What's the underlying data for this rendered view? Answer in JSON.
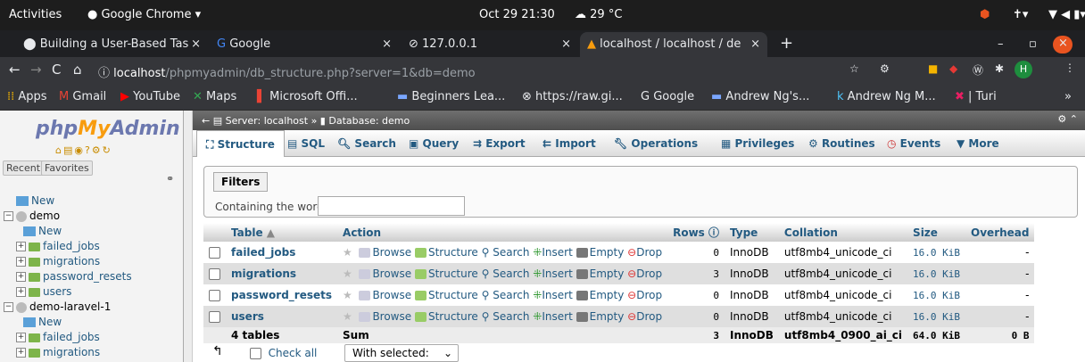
{
  "gnome": {
    "activities": "Activities",
    "app": "Google Chrome ▾",
    "clock": "Oct 29  21:30",
    "weather": "29 °C"
  },
  "tabs": [
    {
      "title": "Building a User-Based Tas"
    },
    {
      "title": "Google"
    },
    {
      "title": "127.0.0.1"
    },
    {
      "title": "localhost / localhost / de"
    }
  ],
  "url": {
    "host": "localhost",
    "path": "/phpmyadmin/db_structure.php?server=1&db=demo"
  },
  "bookmarks": [
    "Apps",
    "Gmail",
    "YouTube",
    "Maps",
    "Microsoft Offi...",
    "Beginners Lea...",
    "https://raw.gi...",
    "Google",
    "Andrew Ng's...",
    "Andrew Ng M...",
    "| Turi"
  ],
  "avatar": "H",
  "sidebar": {
    "logo": {
      "php": "php",
      "my": "My",
      "admin": "Admin"
    },
    "recent": "Recent",
    "favorites": "Favorites",
    "tree": [
      "New",
      "demo",
      "New",
      "failed_jobs",
      "migrations",
      "password_resets",
      "users",
      "demo-laravel-1",
      "New",
      "failed_jobs",
      "migrations"
    ]
  },
  "breadcrumb": {
    "server": "Server: localhost »",
    "database": "Database: demo"
  },
  "navtabs": [
    "Structure",
    "SQL",
    "Search",
    "Query",
    "Export",
    "Import",
    "Operations",
    "Privileges",
    "Routines",
    "Events",
    "More"
  ],
  "filters": {
    "legend": "Filters",
    "label": "Containing the word:"
  },
  "table": {
    "headers": [
      "Table",
      "Action",
      "Rows",
      "Type",
      "Collation",
      "Size",
      "Overhead"
    ],
    "actions": [
      "Browse",
      "Structure",
      "Search",
      "Insert",
      "Empty",
      "Drop"
    ],
    "rows": [
      {
        "name": "failed_jobs",
        "rows": "0",
        "type": "InnoDB",
        "collation": "utf8mb4_unicode_ci",
        "size": "16.0 KiB",
        "overhead": "-"
      },
      {
        "name": "migrations",
        "rows": "3",
        "type": "InnoDB",
        "collation": "utf8mb4_unicode_ci",
        "size": "16.0 KiB",
        "overhead": "-"
      },
      {
        "name": "password_resets",
        "rows": "0",
        "type": "InnoDB",
        "collation": "utf8mb4_unicode_ci",
        "size": "16.0 KiB",
        "overhead": "-"
      },
      {
        "name": "users",
        "rows": "0",
        "type": "InnoDB",
        "collation": "utf8mb4_unicode_ci",
        "size": "16.0 KiB",
        "overhead": "-"
      }
    ],
    "footer": {
      "name": "4 tables",
      "action": "Sum",
      "rows": "3",
      "type": "InnoDB",
      "collation": "utf8mb4_0900_ai_ci",
      "size": "64.0 KiB",
      "overhead": "0 B"
    }
  },
  "bottom": {
    "check_all": "Check all",
    "with_selected": "With selected:"
  }
}
